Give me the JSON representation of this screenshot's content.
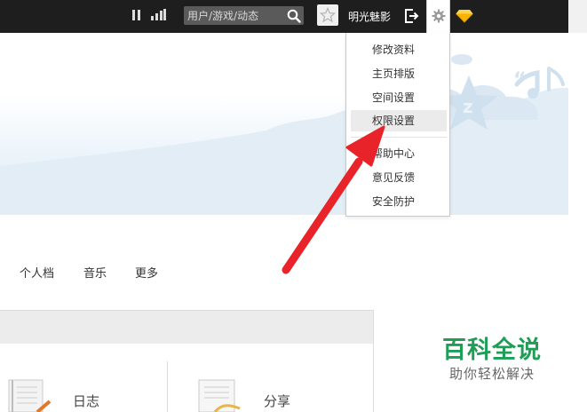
{
  "topbar": {
    "search": {
      "placeholder": "用户/游戏/动态"
    },
    "username": "明光魅影"
  },
  "settings_menu": {
    "items": [
      {
        "label": "修改资料"
      },
      {
        "label": "主页排版"
      },
      {
        "label": "空间设置"
      },
      {
        "label": "权限设置",
        "state": "highlighted"
      },
      {
        "label": "帮助中心"
      },
      {
        "label": "意见反馈"
      },
      {
        "label": "安全防护"
      }
    ]
  },
  "nav": {
    "items": [
      {
        "label": "个人档"
      },
      {
        "label": "音乐"
      },
      {
        "label": "更多"
      }
    ]
  },
  "content": {
    "entries": [
      {
        "label": "日志",
        "icon": "diary-icon"
      },
      {
        "label": "分享",
        "icon": "share-icon"
      }
    ]
  },
  "watermark": {
    "title": "百科全说",
    "subtitle": "助你轻松解决"
  },
  "colors": {
    "topbar_bg": "#1e1e1e",
    "annotation_arrow": "#e8232a",
    "watermark_green": "#1f9e57",
    "menu_highlight": "#ebebeb"
  }
}
